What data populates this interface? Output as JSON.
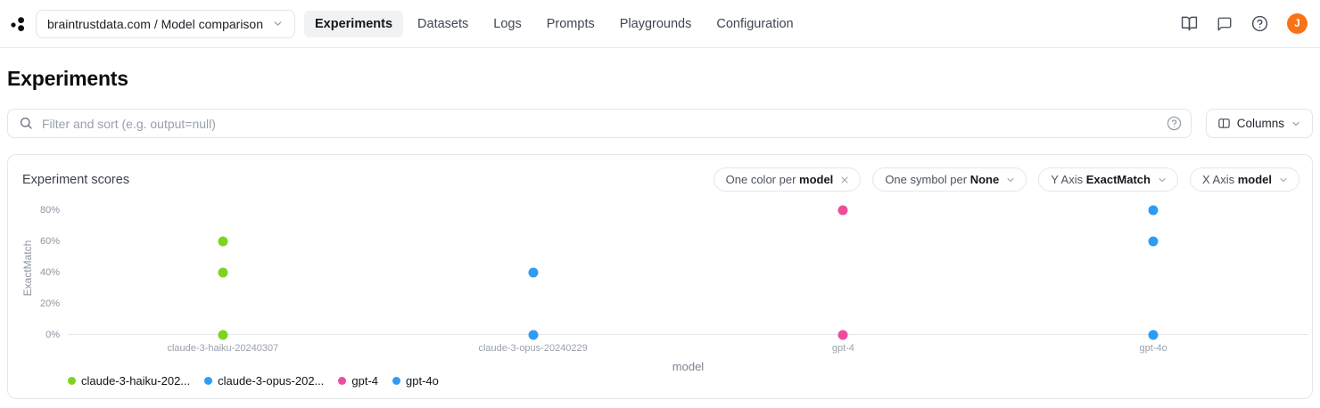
{
  "topbar": {
    "breadcrumb": {
      "label": "braintrustdata.com / Model comparison"
    },
    "tabs": [
      {
        "label": "Experiments",
        "active": true
      },
      {
        "label": "Datasets",
        "active": false
      },
      {
        "label": "Logs",
        "active": false
      },
      {
        "label": "Prompts",
        "active": false
      },
      {
        "label": "Playgrounds",
        "active": false
      },
      {
        "label": "Configuration",
        "active": false
      }
    ],
    "icons": [
      "docs-icon",
      "feedback-icon",
      "help-icon"
    ],
    "avatar": {
      "letter": "J",
      "color": "#f97316"
    }
  },
  "page": {
    "title": "Experiments"
  },
  "filter_bar": {
    "placeholder": "Filter and sort (e.g. output=null)",
    "columns_button": "Columns"
  },
  "panel": {
    "title": "Experiment scores",
    "chips": [
      {
        "prefix": "One color per",
        "value": "model",
        "control": "close"
      },
      {
        "prefix": "One symbol per",
        "value": "None",
        "control": "chevron"
      },
      {
        "prefix": "Y Axis",
        "value": "ExactMatch",
        "control": "chevron"
      },
      {
        "prefix": "X Axis",
        "value": "model",
        "control": "chevron"
      }
    ]
  },
  "chart_data": {
    "type": "scatter",
    "title": "Experiment scores",
    "xlabel": "model",
    "ylabel": "ExactMatch",
    "categories": [
      "claude-3-haiku-20240307",
      "claude-3-opus-20240229",
      "gpt-4",
      "gpt-4o"
    ],
    "y_ticks": [
      {
        "label": "0%",
        "value": 0
      },
      {
        "label": "20%",
        "value": 20
      },
      {
        "label": "40%",
        "value": 40
      },
      {
        "label": "60%",
        "value": 60
      },
      {
        "label": "80%",
        "value": 80
      }
    ],
    "ylim_pct": [
      0,
      87
    ],
    "grid": false,
    "legend_position": "bottom-left",
    "series": [
      {
        "legend_label": "claude-3-haiku-202...",
        "category": "claude-3-haiku-20240307",
        "color": "#7ed321",
        "values_pct": [
          60,
          40,
          0
        ]
      },
      {
        "legend_label": "claude-3-opus-202...",
        "category": "claude-3-opus-20240229",
        "color": "#2e9cf5",
        "values_pct": [
          40,
          0
        ]
      },
      {
        "legend_label": "gpt-4",
        "category": "gpt-4",
        "color": "#ee4c9d",
        "values_pct": [
          80,
          0
        ]
      },
      {
        "legend_label": "gpt-4o",
        "category": "gpt-4o",
        "color": "#2e9cf5",
        "values_pct": [
          80,
          60,
          0
        ]
      }
    ]
  }
}
